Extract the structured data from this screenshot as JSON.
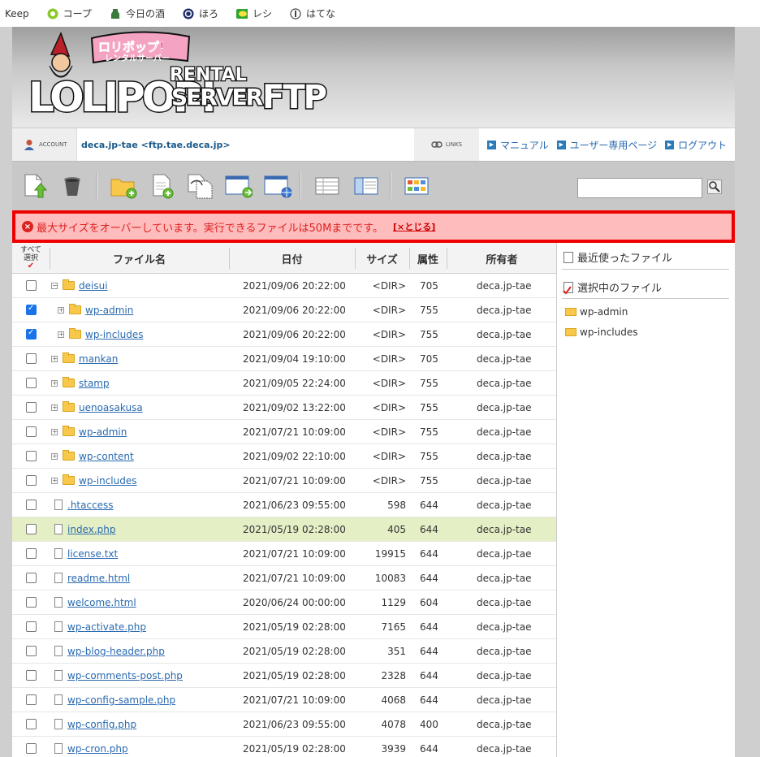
{
  "bookmarks": [
    {
      "label": "Keep",
      "icon": "none"
    },
    {
      "label": "コープ",
      "icon": "coop-icon"
    },
    {
      "label": "今日の酒",
      "icon": "sake-icon"
    },
    {
      "label": "ほろ",
      "icon": "horo-icon"
    },
    {
      "label": "レシ",
      "icon": "recipe-icon"
    },
    {
      "label": "はてな",
      "icon": "hatena-icon"
    }
  ],
  "header": {
    "logo_top": "ロリポップ!",
    "logo_sub": "レンタルサーバー",
    "logo_main1": "LOLIPOP!",
    "logo_rental": "RENTAL",
    "logo_server": "SERVER",
    "logo_ftp": "FTP"
  },
  "account": {
    "label": "ACCOUNT",
    "value": "deca.jp-tae <ftp.tae.deca.jp>",
    "links_label": "LINKS",
    "links": [
      "マニュアル",
      "ユーザー専用ページ",
      "ログアウト"
    ]
  },
  "error": {
    "message": "最大サイズをオーバーしています。実行できるファイルは50Mまでです。",
    "close_label": "[×とじる]"
  },
  "table": {
    "headers": {
      "select_all_line1": "すべて",
      "select_all_line2": "選択",
      "name": "ファイル名",
      "date": "日付",
      "size": "サイズ",
      "perm": "属性",
      "owner": "所有者"
    },
    "rows": [
      {
        "name": "deisui",
        "date": "2021/09/06 20:22:00",
        "size": "<DIR>",
        "perm": "705",
        "owner": "deca.jp-tae"
      },
      {
        "name": "wp-admin",
        "date": "2021/09/06 20:22:00",
        "size": "<DIR>",
        "perm": "755",
        "owner": "deca.jp-tae"
      },
      {
        "name": "wp-includes",
        "date": "2021/09/06 20:22:00",
        "size": "<DIR>",
        "perm": "755",
        "owner": "deca.jp-tae"
      },
      {
        "name": "mankan",
        "date": "2021/09/04 19:10:00",
        "size": "<DIR>",
        "perm": "705",
        "owner": "deca.jp-tae"
      },
      {
        "name": "stamp",
        "date": "2021/09/05 22:24:00",
        "size": "<DIR>",
        "perm": "755",
        "owner": "deca.jp-tae"
      },
      {
        "name": "uenoasakusa",
        "date": "2021/09/02 13:22:00",
        "size": "<DIR>",
        "perm": "755",
        "owner": "deca.jp-tae"
      },
      {
        "name": "wp-admin",
        "date": "2021/07/21 10:09:00",
        "size": "<DIR>",
        "perm": "755",
        "owner": "deca.jp-tae"
      },
      {
        "name": "wp-content",
        "date": "2021/09/02 22:10:00",
        "size": "<DIR>",
        "perm": "755",
        "owner": "deca.jp-tae"
      },
      {
        "name": "wp-includes",
        "date": "2021/07/21 10:09:00",
        "size": "<DIR>",
        "perm": "755",
        "owner": "deca.jp-tae"
      },
      {
        "name": ".htaccess",
        "date": "2021/06/23 09:55:00",
        "size": "598",
        "perm": "644",
        "owner": "deca.jp-tae"
      },
      {
        "name": "index.php",
        "date": "2021/05/19 02:28:00",
        "size": "405",
        "perm": "644",
        "owner": "deca.jp-tae"
      },
      {
        "name": "license.txt",
        "date": "2021/07/21 10:09:00",
        "size": "19915",
        "perm": "644",
        "owner": "deca.jp-tae"
      },
      {
        "name": "readme.html",
        "date": "2021/07/21 10:09:00",
        "size": "10083",
        "perm": "644",
        "owner": "deca.jp-tae"
      },
      {
        "name": "welcome.html",
        "date": "2020/06/24 00:00:00",
        "size": "1129",
        "perm": "604",
        "owner": "deca.jp-tae"
      },
      {
        "name": "wp-activate.php",
        "date": "2021/05/19 02:28:00",
        "size": "7165",
        "perm": "644",
        "owner": "deca.jp-tae"
      },
      {
        "name": "wp-blog-header.php",
        "date": "2021/05/19 02:28:00",
        "size": "351",
        "perm": "644",
        "owner": "deca.jp-tae"
      },
      {
        "name": "wp-comments-post.php",
        "date": "2021/05/19 02:28:00",
        "size": "2328",
        "perm": "644",
        "owner": "deca.jp-tae"
      },
      {
        "name": "wp-config-sample.php",
        "date": "2021/07/21 10:09:00",
        "size": "4068",
        "perm": "644",
        "owner": "deca.jp-tae"
      },
      {
        "name": "wp-config.php",
        "date": "2021/06/23 09:55:00",
        "size": "4078",
        "perm": "400",
        "owner": "deca.jp-tae"
      },
      {
        "name": "wp-cron.php",
        "date": "2021/05/19 02:28:00",
        "size": "3939",
        "perm": "644",
        "owner": "deca.jp-tae"
      }
    ]
  },
  "right_panel": {
    "recent_label": "最近使ったファイル",
    "selected_label": "選択中のファイル",
    "selected_items": [
      "wp-admin",
      "wp-includes"
    ]
  }
}
